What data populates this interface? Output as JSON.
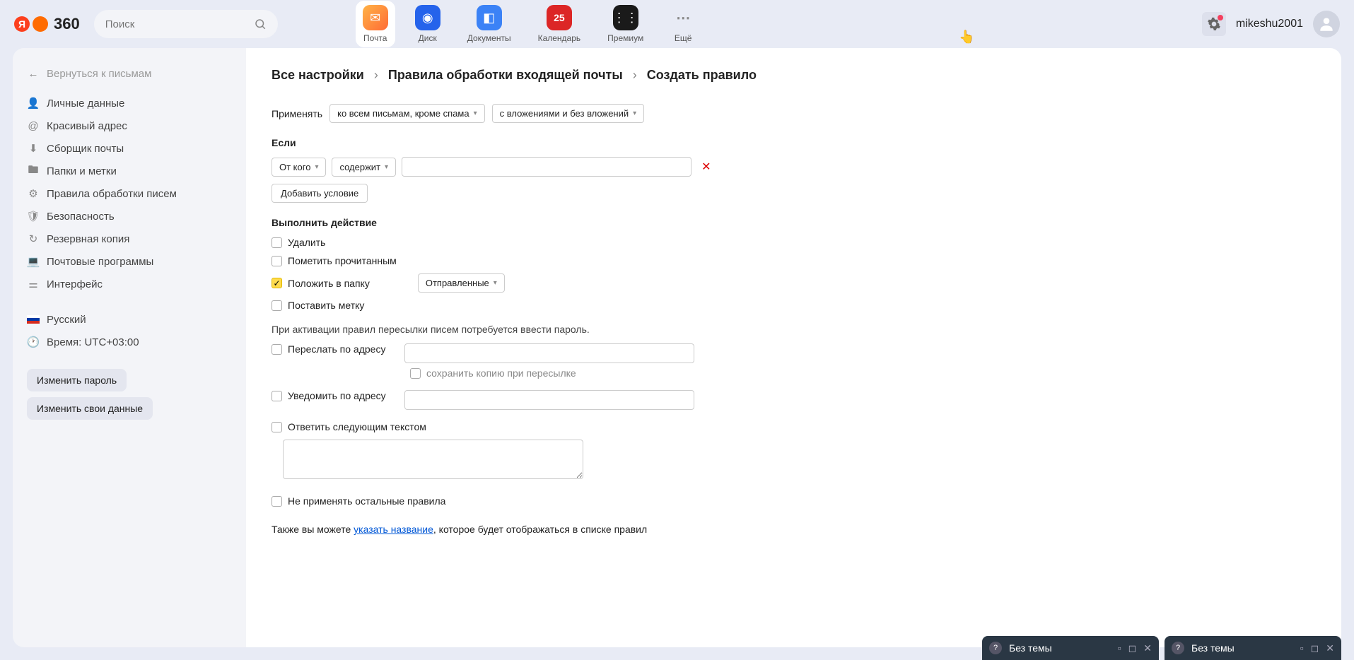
{
  "header": {
    "logo_text": "360",
    "search_placeholder": "Поиск",
    "apps": [
      {
        "label": "Почта",
        "active": true
      },
      {
        "label": "Диск"
      },
      {
        "label": "Документы"
      },
      {
        "label": "Календарь",
        "badge": "25"
      },
      {
        "label": "Премиум"
      },
      {
        "label": "Ещё"
      }
    ],
    "username": "mikeshu2001"
  },
  "sidebar": {
    "back": "Вернуться к письмам",
    "items": [
      "Личные данные",
      "Красивый адрес",
      "Сборщик почты",
      "Папки и метки",
      "Правила обработки писем",
      "Безопасность",
      "Резервная копия",
      "Почтовые программы",
      "Интерфейс"
    ],
    "language": "Русский",
    "timezone": "Время: UTC+03:00",
    "btn_password": "Изменить пароль",
    "btn_data": "Изменить свои данные"
  },
  "breadcrumb": [
    "Все настройки",
    "Правила обработки входящей почты",
    "Создать правило"
  ],
  "form": {
    "apply_label": "Применять",
    "apply_dd1": "ко всем письмам, кроме спама",
    "apply_dd2": "с вложениями и без вложений",
    "if_label": "Если",
    "cond_field": "От кого",
    "cond_op": "содержит",
    "add_condition": "Добавить условие",
    "action_title": "Выполнить действие",
    "act_delete": "Удалить",
    "act_read": "Пометить прочитанным",
    "act_folder": "Положить в папку",
    "act_folder_dd": "Отправленные",
    "act_label": "Поставить метку",
    "forward_note": "При активации правил пересылки писем потребуется ввести пароль.",
    "act_forward": "Переслать по адресу",
    "act_forward_copy": "сохранить копию при пересылке",
    "act_notify": "Уведомить по адресу",
    "act_reply": "Ответить следующим текстом",
    "act_skip_other": "Не применять остальные правила",
    "footer_pre": "Также вы можете ",
    "footer_link": "указать название",
    "footer_post": ", которое будет отображаться в списке правил"
  },
  "chat": {
    "title": "Без темы"
  }
}
